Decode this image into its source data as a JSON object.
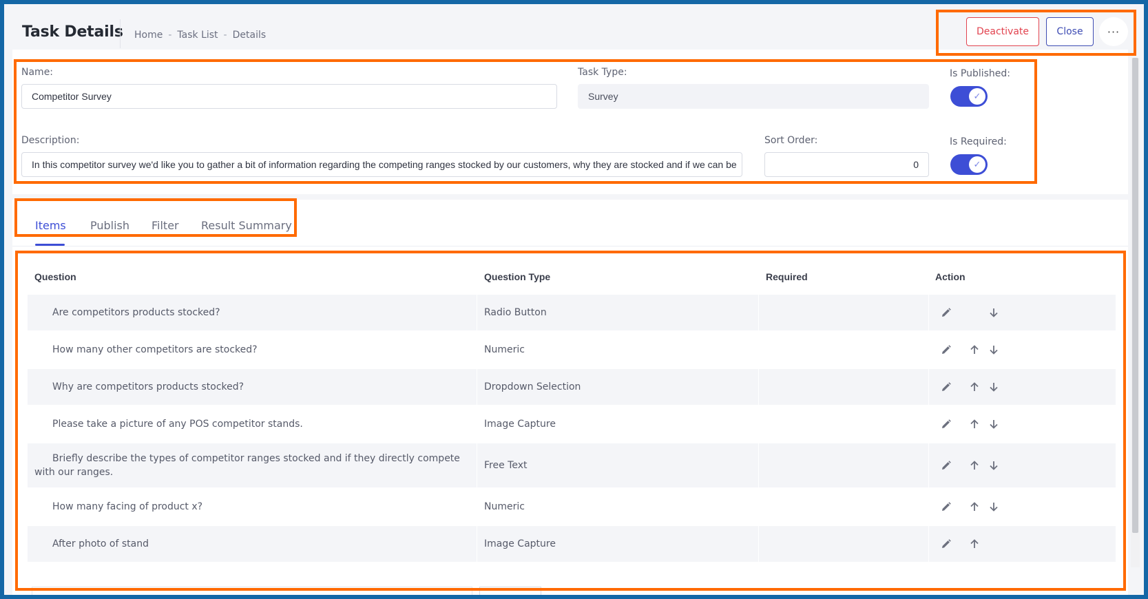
{
  "header": {
    "title": "Task Details",
    "breadcrumb": [
      "Home",
      "Task List",
      "Details"
    ],
    "breadcrumb_sep": "-",
    "deactivate_label": "Deactivate",
    "close_label": "Close",
    "more_label": "···"
  },
  "form": {
    "name_label": "Name:",
    "name_value": "Competitor Survey",
    "task_type_label": "Task Type:",
    "task_type_value": "Survey",
    "is_published_label": "Is Published:",
    "is_published": true,
    "description_label": "Description:",
    "description_value": "In this competitor survey we'd like you to gather a bit of information regarding the competing ranges stocked by our customers, why they are stocked and if we can be",
    "sort_order_label": "Sort Order:",
    "sort_order_value": "0",
    "is_required_label": "Is Required:",
    "is_required": true
  },
  "tabs": [
    {
      "label": "Items",
      "active": true
    },
    {
      "label": "Publish",
      "active": false
    },
    {
      "label": "Filter",
      "active": false
    },
    {
      "label": "Result Summary",
      "active": false
    }
  ],
  "table": {
    "headers": {
      "question": "Question",
      "type": "Question Type",
      "required": "Required",
      "action": "Action"
    },
    "rows": [
      {
        "question": "Are competitors products stocked?",
        "type": "Radio Button",
        "required": "",
        "up": false,
        "down": true
      },
      {
        "question": "How many other competitors are stocked?",
        "type": "Numeric",
        "required": "",
        "up": true,
        "down": true
      },
      {
        "question": "Why are competitors products stocked?",
        "type": "Dropdown Selection",
        "required": "",
        "up": true,
        "down": true
      },
      {
        "question": "Please take a picture of any POS competitor stands.",
        "type": "Image Capture",
        "required": "",
        "up": true,
        "down": true
      },
      {
        "question": "Briefly describe the types of competitor ranges stocked and if they directly compete with our ranges.",
        "type": "Free Text",
        "required": "",
        "up": true,
        "down": true
      },
      {
        "question": "How many facing of product x?",
        "type": "Numeric",
        "required": "",
        "up": true,
        "down": true
      },
      {
        "question": "After photo of stand",
        "type": "Image Capture",
        "required": "",
        "up": true,
        "down": false
      }
    ]
  },
  "colors": {
    "accent": "#3d4ed6",
    "danger": "#e2434f",
    "highlight": "#ff6a00",
    "frame": "#1467a6"
  },
  "icons": {
    "edit": "pencil-icon",
    "up": "arrow-up-icon",
    "down": "arrow-down-icon",
    "more": "more-dots-icon",
    "check": "check-icon"
  }
}
